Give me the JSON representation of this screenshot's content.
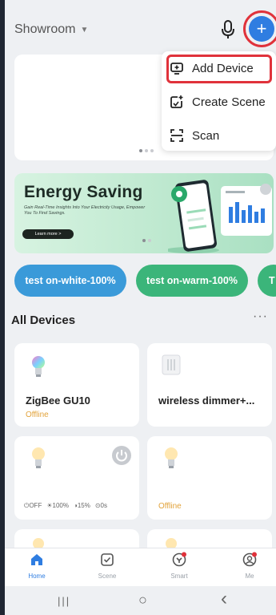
{
  "header": {
    "home_name": "Showroom",
    "caret": "▼"
  },
  "popup_menu": {
    "items": [
      {
        "label": "Add Device",
        "icon": "add-device-icon"
      },
      {
        "label": "Create Scene",
        "icon": "create-scene-icon"
      },
      {
        "label": "Scan",
        "icon": "scan-icon"
      }
    ]
  },
  "banner": {
    "title": "Energy Saving",
    "subtitle": "Gain Real-Time Insights Into Your Electricity Usage, Empower You To Find Savings.",
    "button_label": "Learn more >"
  },
  "scenes": [
    {
      "label": "test on-white-100%",
      "color": "#3a9ad9"
    },
    {
      "label": "test on-warm-100%",
      "color": "#3bb57a"
    },
    {
      "label": "T",
      "color": "#3bb57a"
    }
  ],
  "devices_section": {
    "title": "All Devices",
    "more": "···"
  },
  "devices": [
    {
      "name": "ZigBee GU10",
      "status": "Offline"
    },
    {
      "name": "wireless dimmer+...",
      "status": ""
    },
    {
      "name": "",
      "status": "",
      "stats": {
        "power": "OFF",
        "brightness": "100%",
        "temp": "15%",
        "timer": "0s"
      }
    },
    {
      "name": "",
      "status": "Offline"
    }
  ],
  "nav": [
    {
      "label": "Home",
      "icon": "home-icon",
      "active": true
    },
    {
      "label": "Scene",
      "icon": "scene-icon",
      "active": false
    },
    {
      "label": "Smart",
      "icon": "smart-icon",
      "active": false
    },
    {
      "label": "Me",
      "icon": "me-icon",
      "active": false
    }
  ],
  "system_nav": {
    "recents": "|||",
    "home": "○",
    "back": "‹"
  },
  "colors": {
    "accent": "#2f7de1",
    "highlight": "#e0323b",
    "offline": "#e2a33b"
  }
}
